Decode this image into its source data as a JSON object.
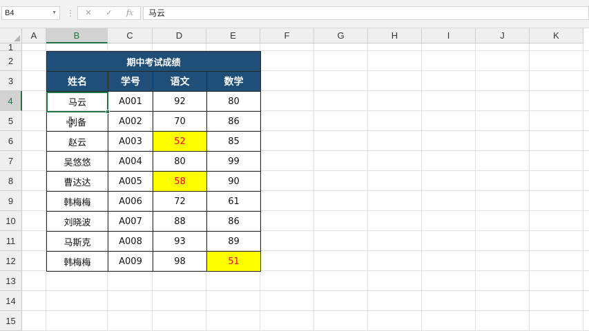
{
  "formula_bar": {
    "name_box": "B4",
    "formula": "马云",
    "cancel_icon": "✕",
    "enter_icon": "✓",
    "fx_label": "fx"
  },
  "columns": [
    "A",
    "B",
    "C",
    "D",
    "E",
    "F",
    "G",
    "H",
    "I",
    "J",
    "K"
  ],
  "rows": [
    "1",
    "2",
    "3",
    "4",
    "5",
    "6",
    "7",
    "8",
    "9",
    "10",
    "11",
    "12",
    "13",
    "14",
    "15"
  ],
  "selected_cell": "B4",
  "table": {
    "title": "期中考试成绩",
    "headers": [
      "姓名",
      "学号",
      "语文",
      "数学"
    ],
    "rows": [
      [
        "马云",
        "A001",
        "92",
        "80"
      ],
      [
        "刘备",
        "A002",
        "70",
        "86"
      ],
      [
        "赵云",
        "A003",
        "52",
        "85"
      ],
      [
        "吴悠悠",
        "A004",
        "80",
        "99"
      ],
      [
        "曹达达",
        "A005",
        "58",
        "90"
      ],
      [
        "韩梅梅",
        "A006",
        "72",
        "61"
      ],
      [
        "刘晓波",
        "A007",
        "88",
        "86"
      ],
      [
        "马斯克",
        "A008",
        "93",
        "89"
      ],
      [
        "韩梅梅",
        "A009",
        "98",
        "51"
      ]
    ]
  },
  "colors": {
    "header_fill": "#1f4e79",
    "highlight_fill": "#ffff00",
    "highlight_text": "#ff0000",
    "selection": "#217346"
  },
  "icons": {
    "cursor": "move-cursor-icon"
  }
}
